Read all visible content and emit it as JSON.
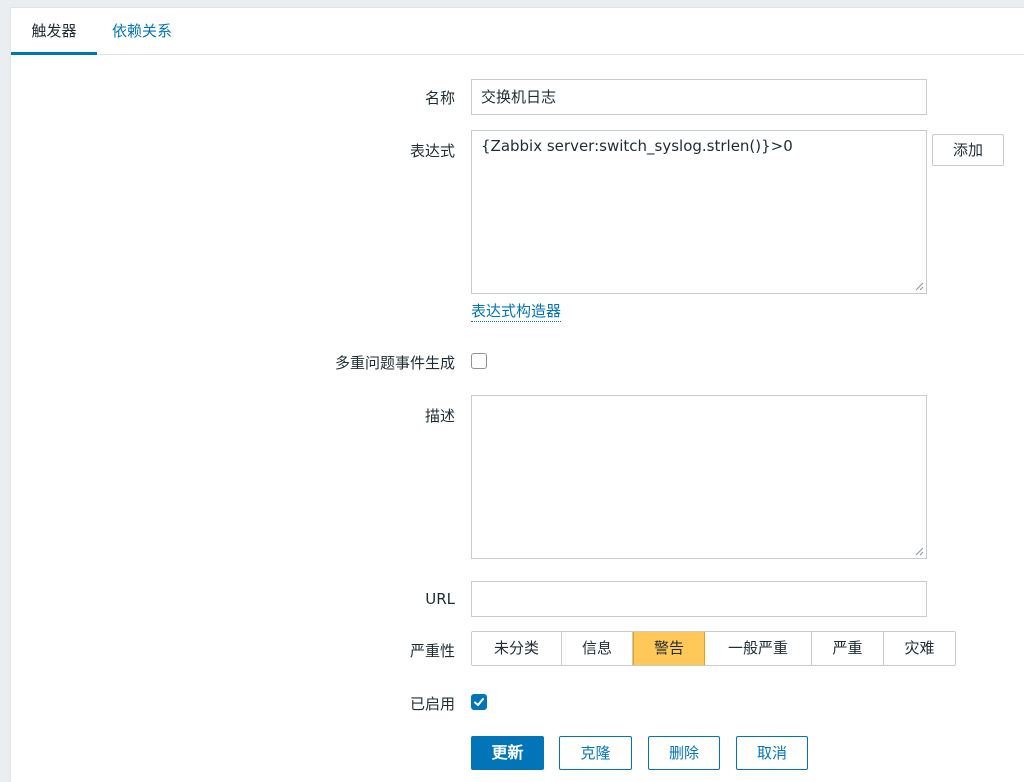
{
  "tabs": [
    {
      "label": "触发器",
      "active": true
    },
    {
      "label": "依赖关系",
      "active": false
    }
  ],
  "form": {
    "name": {
      "label": "名称",
      "value": "交换机日志"
    },
    "expression": {
      "label": "表达式",
      "value": "{Zabbix server:switch_syslog.strlen()}>0",
      "add_label": "添加"
    },
    "expression_builder": "表达式构造器",
    "multiple_events": {
      "label": "多重问题事件生成",
      "checked": false
    },
    "description": {
      "label": "描述",
      "value": ""
    },
    "url": {
      "label": "URL",
      "value": ""
    },
    "severity": {
      "label": "严重性",
      "options": [
        "未分类",
        "信息",
        "警告",
        "一般严重",
        "严重",
        "灾难"
      ],
      "selected": "警告"
    },
    "enabled": {
      "label": "已启用",
      "checked": true
    }
  },
  "actions": {
    "update": "更新",
    "clone": "克隆",
    "delete": "删除",
    "cancel": "取消"
  },
  "colors": {
    "accent": "#0275b8",
    "severity_warning": "#ffc859"
  }
}
